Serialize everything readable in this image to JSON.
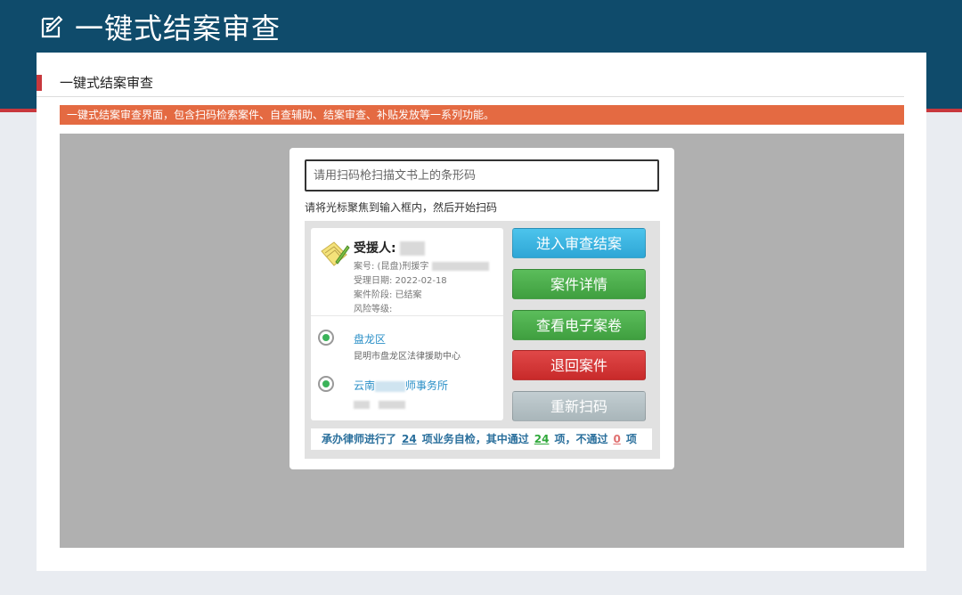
{
  "app": {
    "title": "一键式结案审查"
  },
  "section": {
    "title": "一键式结案审查"
  },
  "notice": {
    "text": "一键式结案审查界面，包含扫码检索案件、自查辅助、结案审查、补贴发放等一系列功能。"
  },
  "dialog": {
    "scan_placeholder": "请用扫码枪扫描文书上的条形码",
    "hint": "请将光标聚焦到输入框内，然后开始扫码",
    "case": {
      "name_label": "受援人:",
      "case_no": "案号: (昆盘)刑援字",
      "accept_date": "受理日期: 2022-02-18",
      "stage": "案件阶段: 已结案",
      "risk": "风险等级:"
    },
    "orgs": [
      {
        "name": "盘龙区",
        "sub": "昆明市盘龙区法律援助中心"
      },
      {
        "name_prefix": "云南",
        "name_suffix": "师事务所"
      }
    ],
    "buttons": {
      "enter_review": "进入审查结案",
      "case_detail": "案件详情",
      "view_archive": "查看电子案卷",
      "return_case": "退回案件",
      "rescan": "重新扫码"
    },
    "summary": {
      "prefix": "承办律师进行了",
      "total": "24",
      "mid": "项业务自检，其中通过",
      "passed": "24",
      "mid2": "项，不通过",
      "failed": "0",
      "suffix": "项"
    }
  },
  "colors": {
    "header": "#0f4b6b",
    "notice": "#e46a42",
    "accent_red": "#c8383d"
  }
}
